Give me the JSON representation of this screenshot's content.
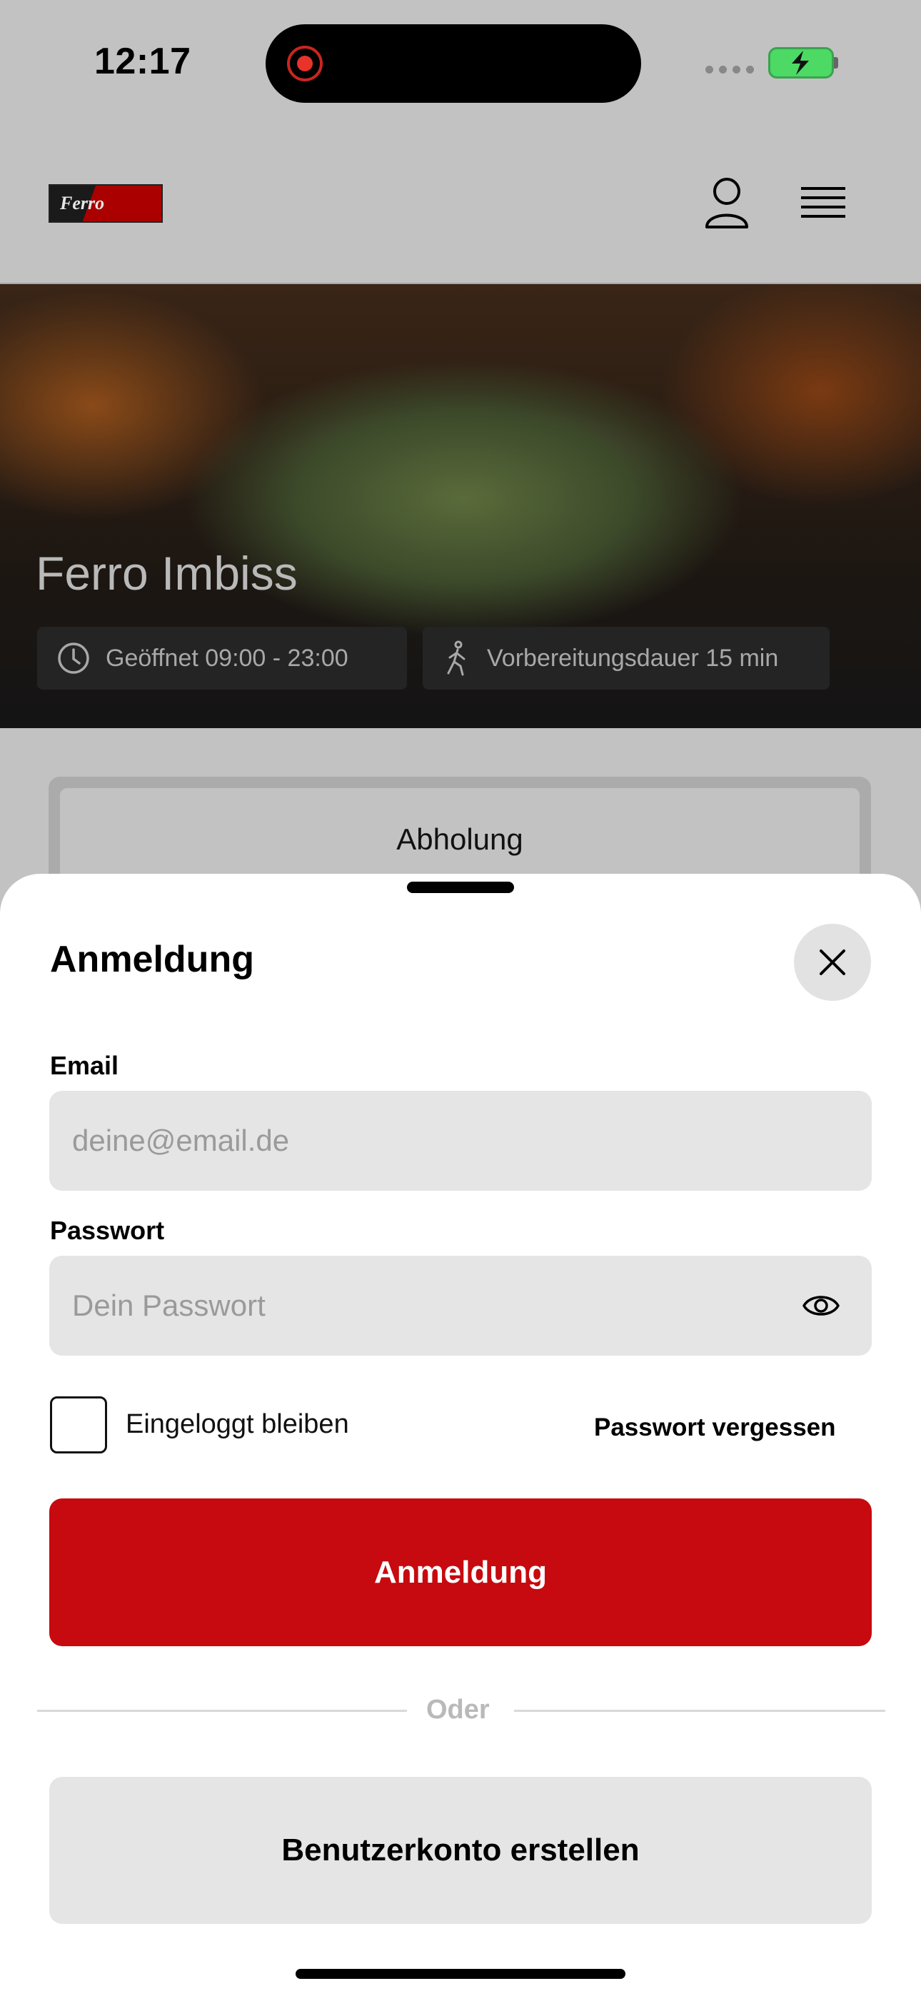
{
  "status_bar": {
    "time": "12:17"
  },
  "header": {
    "logo_text": "Ferro Imbiss"
  },
  "hero": {
    "title": "Ferro Imbiss",
    "opening_hours": "Geöffnet 09:00 - 23:00",
    "prep_time": "Vorbereitungsdauer 15 min"
  },
  "tabs": {
    "active": "Abholung"
  },
  "login_sheet": {
    "title": "Anmeldung",
    "email_label": "Email",
    "email_placeholder": "deine@email.de",
    "password_label": "Passwort",
    "password_placeholder": "Dein Passwort",
    "stay_logged_in": "Eingeloggt bleiben",
    "stay_logged_in_checked": false,
    "forgot_password": "Passwort vergessen",
    "submit_label": "Anmeldung",
    "divider_text": "Oder",
    "create_account": "Benutzerkonto erstellen"
  },
  "colors": {
    "primary": "#c60a0f",
    "field_bg": "#e5e5e5",
    "overlay": "#c2c2c2"
  },
  "icons": [
    "record-icon",
    "battery-charging-icon",
    "user-icon",
    "menu-icon",
    "clock-icon",
    "walking-icon",
    "close-icon",
    "eye-icon"
  ]
}
